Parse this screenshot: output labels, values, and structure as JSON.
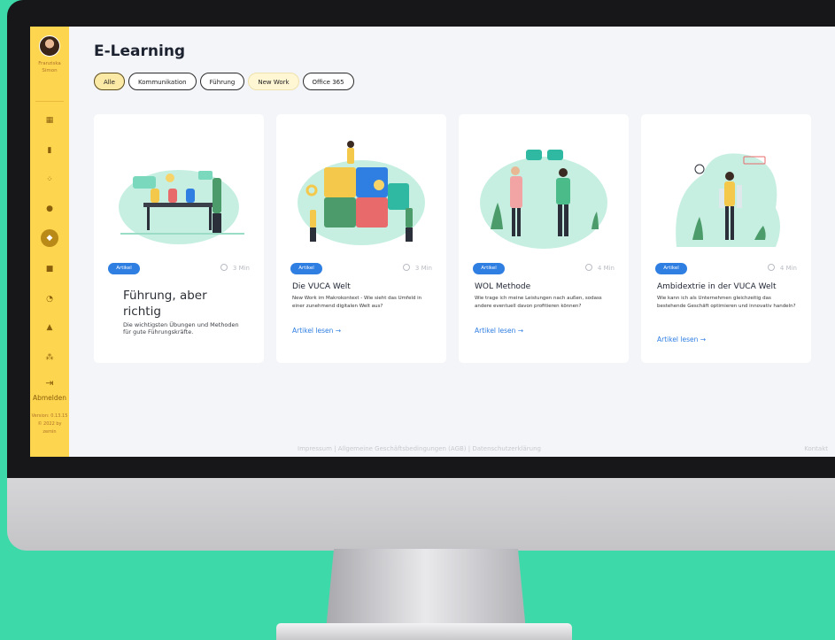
{
  "user": {
    "first_name": "Franziska",
    "last_name": "Simon"
  },
  "nav_items": [
    "dashboard-icon",
    "chart-icon",
    "analytics-icon",
    "idea-icon",
    "graduation-cap-icon",
    "chat-icon",
    "gauge-icon",
    "person-icon",
    "team-icon",
    "logout-icon"
  ],
  "logout_label": "Abmelden",
  "version": {
    "line1": "Version: 0.13.15",
    "line2": "© 2022 by",
    "line3": "zemin"
  },
  "page_title": "E-Learning",
  "filters": [
    "Alle",
    "Kommunikation",
    "Führung",
    "New Work",
    "Office 365"
  ],
  "cards": [
    {
      "tag": "Artikel",
      "duration": "3 Min",
      "title": "Führung, aber richtig",
      "description": "Die wichtigsten Übungen und Methoden für gute Führungskräfte."
    },
    {
      "tag": "Artikel",
      "duration": "3 Min",
      "title": "Die VUCA Welt",
      "description": "New Work im Makrokontext - Wie sieht das Umfeld in einer zunehmend digitalen Welt aus?",
      "link": "Artikel lesen →"
    },
    {
      "tag": "Artikel",
      "duration": "4 Min",
      "title": "WOL Methode",
      "description": "Wie trage ich meine Leistungen nach außen, sodass andere eventuell davon profitieren können?",
      "link": "Artikel lesen →"
    },
    {
      "tag": "Artikel",
      "duration": "4 Min",
      "title": "Ambidextrie in der VUCA Welt",
      "description": "Wie kann ich als Unternehmen gleichzeitig das bestehende Geschäft optimieren und innovativ handeln?",
      "link": "Artikel lesen →"
    }
  ],
  "footer": {
    "links": "Impressum | Allgemeine Geschäftsbedingungen (AGB) | Datenschutzerklärung",
    "contact": "Kontakt"
  },
  "colors": {
    "sidebar": "#fdd54f",
    "accent": "#2f7ee2",
    "background": "#3ed9a8",
    "mint": "#bfeee0"
  }
}
